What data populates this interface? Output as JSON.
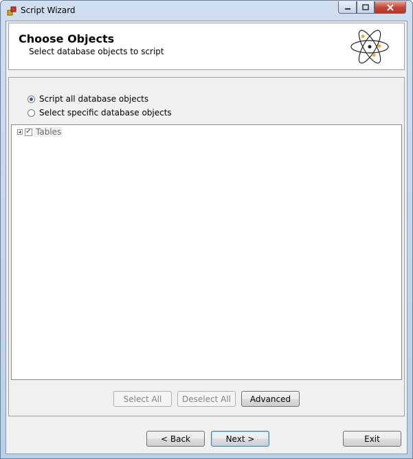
{
  "window": {
    "title": "Script Wizard"
  },
  "header": {
    "title": "Choose Objects",
    "subtitle": "Select database objects to script"
  },
  "options": {
    "script_all": "Script all database objects",
    "select_specific": "Select specific database objects",
    "selected": "script_all"
  },
  "tree": {
    "nodes": [
      {
        "label": "Tables",
        "checked": true,
        "expanded": false
      }
    ]
  },
  "selection_buttons": {
    "select_all": "Select All",
    "deselect_all": "Deselect All",
    "advanced": "Advanced"
  },
  "nav_buttons": {
    "back": "< Back",
    "next": "Next >",
    "exit": "Exit"
  },
  "icons": [
    "app-icon",
    "minimize-icon",
    "maximize-icon",
    "close-icon",
    "atom-icon",
    "expand-icon",
    "checkbox-icon"
  ]
}
